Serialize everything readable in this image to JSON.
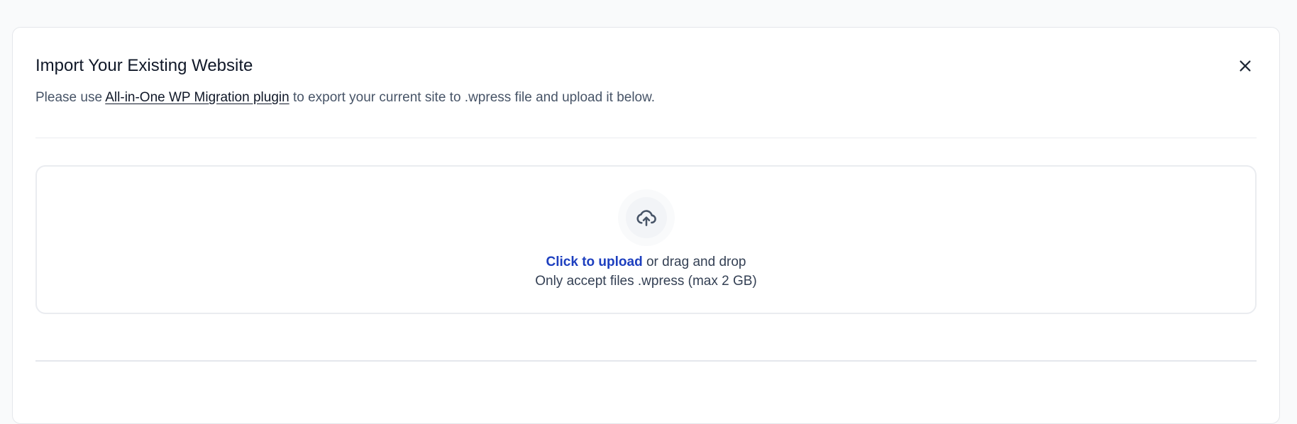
{
  "modal": {
    "title": "Import Your Existing Website",
    "subtitle_prefix": "Please use ",
    "plugin_link": "All-in-One WP Migration plugin",
    "subtitle_suffix": " to export your current site to .wpress file and upload it below."
  },
  "close_icon": "close-icon",
  "upload": {
    "icon": "cloud-upload-icon",
    "click_label": "Click to upload",
    "drag_label": " or drag and drop",
    "hint": "Only accept files .wpress (max 2 GB)"
  },
  "colors": {
    "link_blue": "#1d3fbf",
    "border": "#eaecf0",
    "page_bg": "#f9fafb"
  }
}
